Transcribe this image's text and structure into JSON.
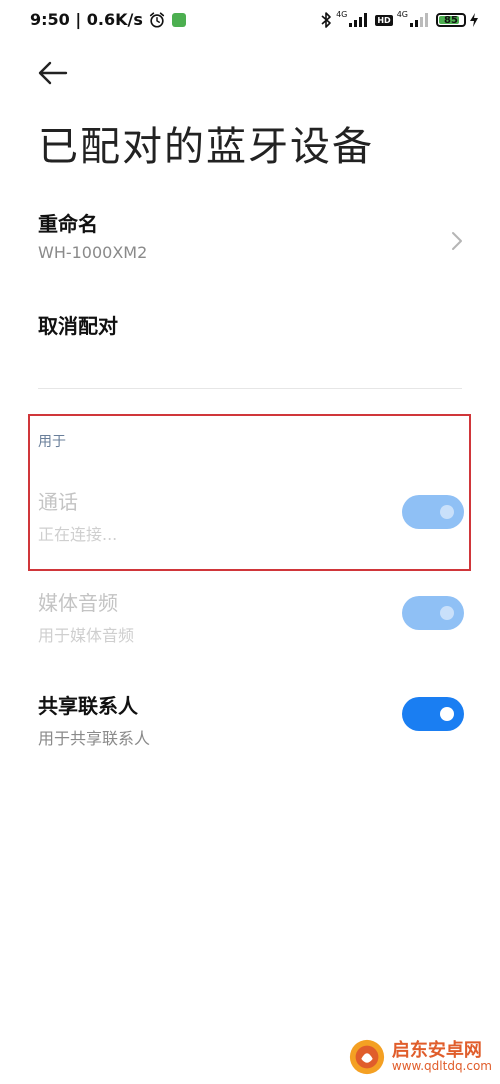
{
  "status_bar": {
    "time_speed": "9:50 | 0.6K/s",
    "network_1": "4G",
    "hd_label": "HD",
    "network_2": "4G",
    "battery_level": "85",
    "battery_fraction": 0.85,
    "battery_color": "#4caf50"
  },
  "header": {
    "title": "已配对的蓝牙设备"
  },
  "rename": {
    "title": "重命名",
    "device_name": "WH-1000XM2"
  },
  "unpair": {
    "title": "取消配对"
  },
  "used_for": {
    "label": "用于",
    "items": [
      {
        "title": "通话",
        "subtitle": "正在连接...",
        "enabled": false,
        "on": true
      },
      {
        "title": "媒体音频",
        "subtitle": "用于媒体音频",
        "enabled": false,
        "on": true
      },
      {
        "title": "共享联系人",
        "subtitle": "用于共享联系人",
        "enabled": true,
        "on": true
      }
    ]
  },
  "colors": {
    "accent": "#1a7ef2",
    "accent_disabled": "#8fc0f5",
    "highlight": "#d0363a"
  },
  "watermark": {
    "title": "启东安卓网",
    "url": "www.qdltdq.com"
  }
}
